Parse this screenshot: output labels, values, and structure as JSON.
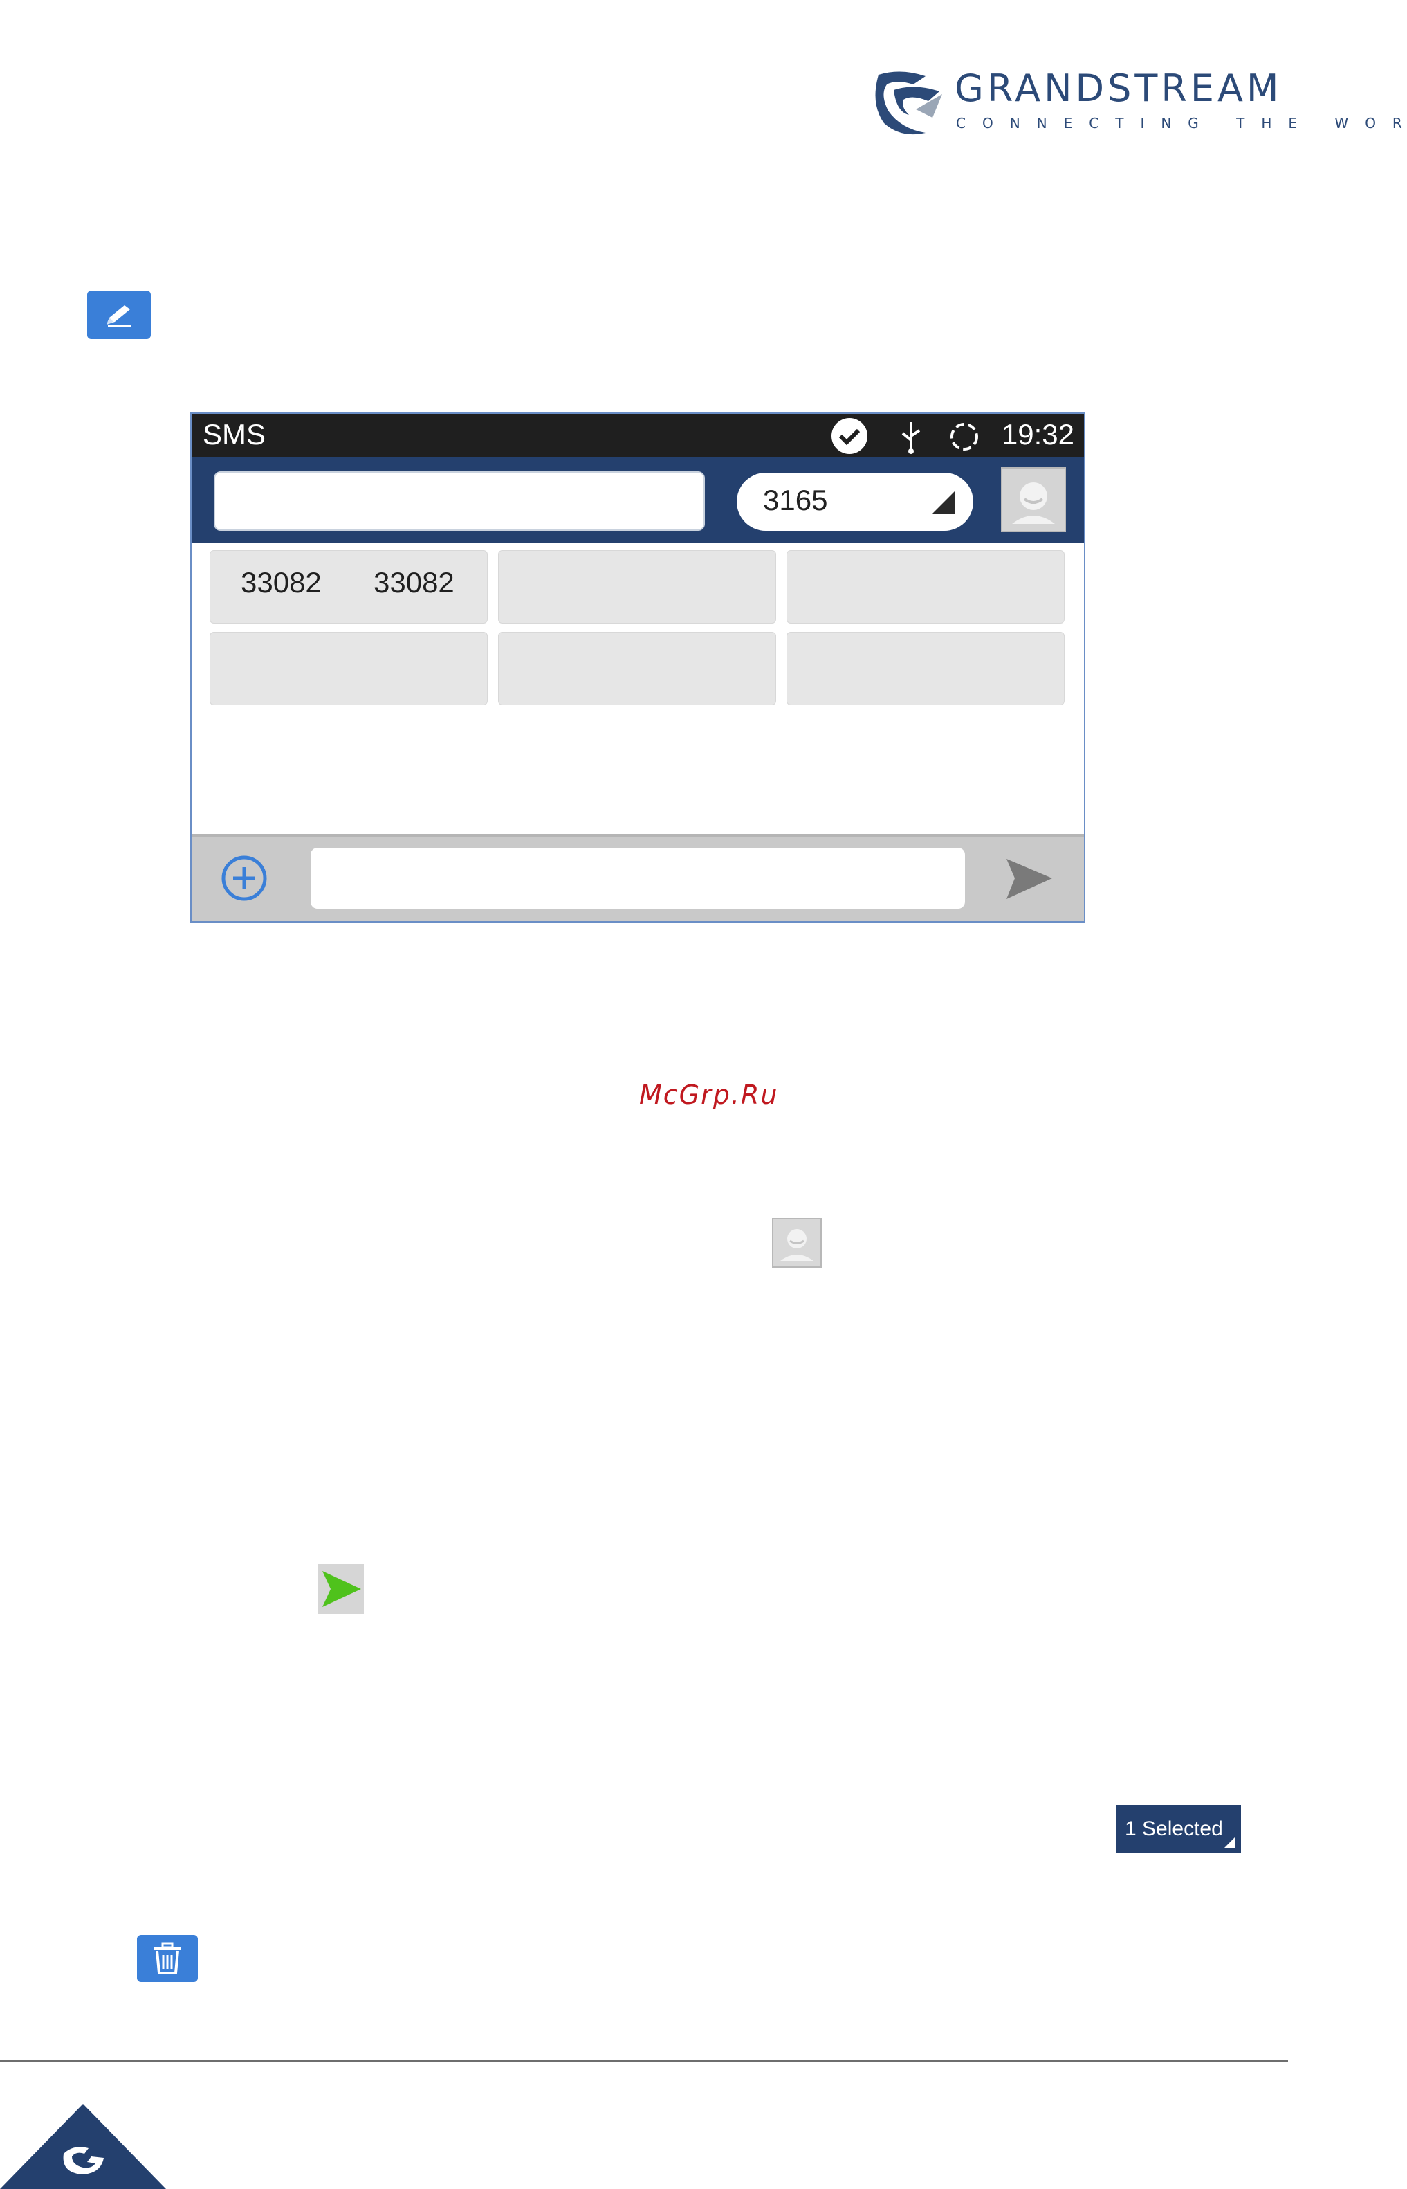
{
  "brand": {
    "name": "GRANDSTREAM",
    "tagline": "CONNECTING THE WORLD",
    "color": "#2c4a78"
  },
  "screen": {
    "status_bar": {
      "title": "SMS",
      "time": "19:32",
      "icons": [
        "skype-check-icon",
        "usb-icon",
        "sync-icon"
      ]
    },
    "header": {
      "to_placeholder": "",
      "account": "3165"
    },
    "recipients": [
      [
        "33082",
        "33082"
      ]
    ],
    "composer": {
      "message_placeholder": ""
    }
  },
  "watermark": "McGrp.Ru",
  "selection_badge": "1 Selected"
}
